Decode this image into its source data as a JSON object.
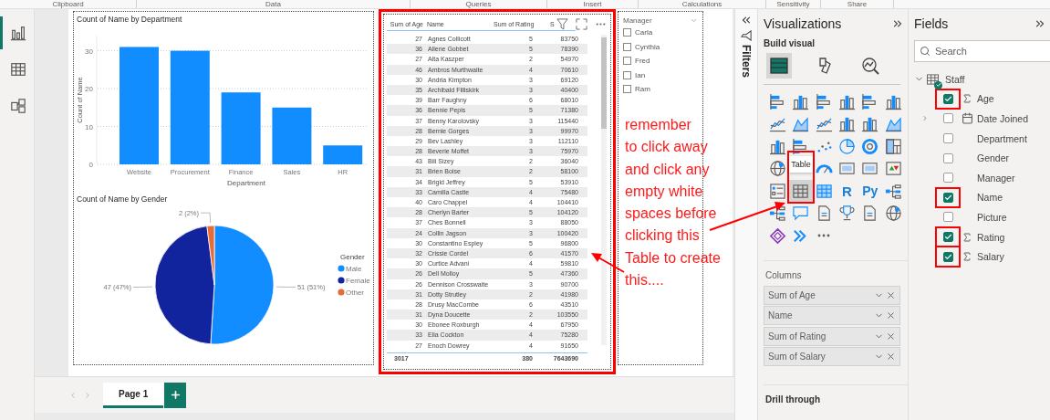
{
  "ribbon_groups": [
    "Clipboard",
    "Data",
    "Queries",
    "Insert",
    "Calculations",
    "Sensitivity",
    "Share"
  ],
  "nav": [
    {
      "kind": "report",
      "selected": true
    },
    {
      "kind": "table",
      "selected": false
    },
    {
      "kind": "model",
      "selected": false
    }
  ],
  "bar_chart": {
    "title": "Count of Name by Department",
    "chart_data": {
      "type": "bar",
      "xlabel": "Department",
      "ylabel": "Count of Name",
      "categories": [
        "Website",
        "Procurement",
        "Finance",
        "Sales",
        "HR"
      ],
      "yticks": [
        0,
        10,
        20,
        30
      ],
      "ylim": [
        0,
        34
      ],
      "grid": true,
      "series": [
        {
          "color": "#118dff",
          "values": [
            31,
            30,
            19,
            15,
            5
          ]
        }
      ]
    }
  },
  "pie_chart": {
    "title": "Count of Name by Gender",
    "legend_title": "Gender",
    "chart_data": {
      "type": "pie",
      "categories": [
        "Male",
        "Female",
        "Other"
      ],
      "colors": [
        "#118dff",
        "#12239e",
        "#e66c37"
      ],
      "legend": "right",
      "value_labels": [
        "51 (51%)",
        "47 (47%)",
        "2 (2%)"
      ],
      "series": [
        {
          "values": [
            51,
            47,
            2
          ]
        }
      ]
    }
  },
  "table": {
    "columns": [
      "Sum of Age",
      "Name",
      "Sum of Rating",
      "S"
    ],
    "rows": [
      [
        "27",
        "Agnes Collicott",
        "5",
        "83750"
      ],
      [
        "36",
        "Allene Gobbet",
        "5",
        "78390"
      ],
      [
        "27",
        "Alta Kaszper",
        "2",
        "54970"
      ],
      [
        "46",
        "Ambros Murthwaite",
        "4",
        "70610"
      ],
      [
        "30",
        "Andria Kimpton",
        "3",
        "69120"
      ],
      [
        "35",
        "Archibald Filliskirk",
        "3",
        "40400"
      ],
      [
        "39",
        "Barr Faughny",
        "6",
        "68010"
      ],
      [
        "36",
        "Bennie Pepis",
        "5",
        "71380"
      ],
      [
        "37",
        "Benny Karolovsky",
        "3",
        "115440"
      ],
      [
        "28",
        "Bernie Gorges",
        "3",
        "99970"
      ],
      [
        "29",
        "Bev Lashley",
        "3",
        "112110"
      ],
      [
        "28",
        "Beverie Moffet",
        "3",
        "75970"
      ],
      [
        "43",
        "Bili Sizey",
        "2",
        "36040"
      ],
      [
        "31",
        "Brien Boise",
        "2",
        "58100"
      ],
      [
        "34",
        "Brigid Jeffrey",
        "5",
        "53910"
      ],
      [
        "33",
        "Camilla Castle",
        "4",
        "75480"
      ],
      [
        "40",
        "Caro Chappel",
        "4",
        "104410"
      ],
      [
        "28",
        "Cherlyn Barter",
        "5",
        "104120"
      ],
      [
        "37",
        "Ches Bonnell",
        "3",
        "88050"
      ],
      [
        "24",
        "Collin Jagson",
        "3",
        "100420"
      ],
      [
        "30",
        "Constantino Espley",
        "5",
        "96800"
      ],
      [
        "32",
        "Crissie Cordel",
        "6",
        "41570"
      ],
      [
        "30",
        "Curtice Advani",
        "4",
        "59810"
      ],
      [
        "26",
        "Dell Molloy",
        "5",
        "47360"
      ],
      [
        "26",
        "Dennison Crosswaite",
        "3",
        "90700"
      ],
      [
        "31",
        "Dotty Strutley",
        "2",
        "41980"
      ],
      [
        "28",
        "Drusy MacCombe",
        "6",
        "43510"
      ],
      [
        "31",
        "Dyna Doucette",
        "2",
        "103550"
      ],
      [
        "30",
        "Ebonee Roxburgh",
        "4",
        "67950"
      ],
      [
        "33",
        "Elia Cockton",
        "4",
        "75280"
      ],
      [
        "27",
        "Enoch Dowrey",
        "4",
        "91650"
      ]
    ],
    "totals": [
      "3017",
      "380",
      "7643690"
    ]
  },
  "slicer": {
    "title": "Manager",
    "items": [
      {
        "label": "Carla",
        "checked": false
      },
      {
        "label": "Cynthia",
        "checked": false
      },
      {
        "label": "Fred",
        "checked": false
      },
      {
        "label": "Ian",
        "checked": false
      },
      {
        "label": "Ram",
        "checked": false
      }
    ]
  },
  "annotation": {
    "lines": [
      "remember",
      "to click away",
      "and click any",
      "empty white",
      "spaces before",
      "clicking this",
      "Table to create",
      "this...."
    ]
  },
  "page_tabs": [
    {
      "label": "Page 1",
      "selected": true
    }
  ],
  "filters": {
    "label": "Filters"
  },
  "visualizations": {
    "title": "Visualizations",
    "subtitle": "Build visual",
    "modes": [
      {
        "kind": "build",
        "selected": true
      },
      {
        "kind": "format",
        "selected": false
      },
      {
        "kind": "analytics",
        "selected": false
      }
    ],
    "types": [
      {
        "kind": "bar",
        "selected": false
      },
      {
        "kind": "column",
        "selected": false
      },
      {
        "kind": "bar",
        "selected": false
      },
      {
        "kind": "column",
        "selected": false
      },
      {
        "kind": "bar",
        "selected": false
      },
      {
        "kind": "column",
        "selected": false
      },
      {
        "kind": "line",
        "selected": false
      },
      {
        "kind": "area",
        "selected": false
      },
      {
        "kind": "line",
        "selected": false
      },
      {
        "kind": "column",
        "selected": false
      },
      {
        "kind": "column",
        "selected": false
      },
      {
        "kind": "area",
        "selected": false
      },
      {
        "kind": "column",
        "selected": false
      },
      {
        "kind": "bar",
        "selected": false
      },
      {
        "kind": "scatter",
        "selected": false
      },
      {
        "kind": "pie",
        "selected": false
      },
      {
        "kind": "donut",
        "selected": false
      },
      {
        "kind": "treemap",
        "selected": false
      },
      {
        "kind": "globe",
        "selected": false
      },
      {
        "kind": "blank",
        "selected": false
      },
      {
        "kind": "gauge",
        "selected": false
      },
      {
        "kind": "card",
        "selected": false
      },
      {
        "kind": "card",
        "selected": false
      },
      {
        "kind": "kpi",
        "selected": false
      },
      {
        "kind": "slicer",
        "selected": false
      },
      {
        "kind": "table",
        "selected": true
      },
      {
        "kind": "matrix",
        "selected": false
      },
      {
        "kind": "text",
        "label": "R",
        "selected": false
      },
      {
        "kind": "text",
        "label": "Py",
        "selected": false
      },
      {
        "kind": "tree",
        "selected": false
      },
      {
        "kind": "tree",
        "selected": false
      },
      {
        "kind": "chat",
        "selected": false
      },
      {
        "kind": "doc",
        "selected": false
      },
      {
        "kind": "trophy",
        "selected": false
      },
      {
        "kind": "doc",
        "selected": false
      },
      {
        "kind": "globe",
        "selected": false
      },
      {
        "kind": "diamond",
        "selected": false
      },
      {
        "kind": "chevrons",
        "selected": false
      },
      {
        "kind": "more",
        "selected": false
      }
    ],
    "tooltip": "Table",
    "wells_label": "Columns",
    "wells": [
      "Sum of Age",
      "Name",
      "Sum of Rating",
      "Sum of Salary"
    ],
    "drill_through": "Drill through"
  },
  "fields": {
    "title": "Fields",
    "search_placeholder": "Search",
    "tables": [
      {
        "name": "Staff",
        "expanded": true,
        "checked": true,
        "children": [
          {
            "name": "Age",
            "kind": "measure",
            "checked": true,
            "highlighted": true
          },
          {
            "name": "Date Joined",
            "kind": "date",
            "checked": false,
            "highlighted": false,
            "expanded": false
          },
          {
            "name": "Department",
            "kind": "text",
            "checked": false,
            "highlighted": false
          },
          {
            "name": "Gender",
            "kind": "text",
            "checked": false,
            "highlighted": false
          },
          {
            "name": "Manager",
            "kind": "text",
            "checked": false,
            "highlighted": false
          },
          {
            "name": "Name",
            "kind": "text",
            "checked": true,
            "highlighted": true
          },
          {
            "name": "Picture",
            "kind": "text",
            "checked": false,
            "highlighted": false
          },
          {
            "name": "Rating",
            "kind": "measure",
            "checked": true,
            "highlighted": true
          },
          {
            "name": "Salary",
            "kind": "measure",
            "checked": true,
            "highlighted": true
          }
        ]
      }
    ]
  }
}
